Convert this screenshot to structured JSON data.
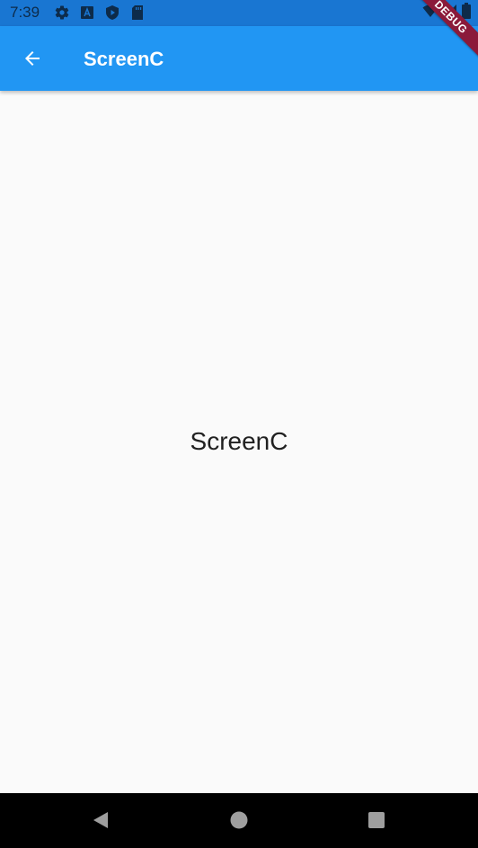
{
  "status_bar": {
    "time": "7:39",
    "left_icons": [
      "settings-icon",
      "a-badge-icon",
      "shield-play-icon",
      "sd-card-icon"
    ],
    "right_icons": [
      "wifi-icon",
      "signal-icon",
      "battery-icon"
    ],
    "color": "#1976d2"
  },
  "app_bar": {
    "title": "ScreenC",
    "back_icon": "arrow-back-icon",
    "color": "#2196f3"
  },
  "debug_banner": {
    "label": "DEBUG"
  },
  "body": {
    "center_text": "ScreenC",
    "background": "#fafafa"
  },
  "nav_bar": {
    "buttons": [
      "back-triangle-icon",
      "home-circle-icon",
      "recents-square-icon"
    ]
  }
}
